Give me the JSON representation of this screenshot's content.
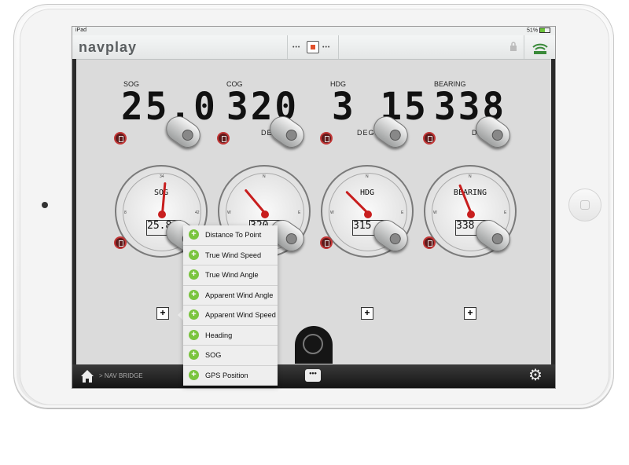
{
  "status": {
    "device": "iPad",
    "battery": "51%"
  },
  "app": {
    "logo": "navplay",
    "breadcrumb": "> NAV BRIDGE"
  },
  "instruments": [
    {
      "label": "SOG",
      "value": "25.0",
      "unit": ""
    },
    {
      "label": "COG",
      "value": "320",
      "unit": "DEG"
    },
    {
      "label": "HDG",
      "value": "3 15",
      "unit": "DEGREE"
    },
    {
      "label": "BEARING",
      "value": "338",
      "unit": "DEG"
    }
  ],
  "dials": [
    {
      "name": "SOG",
      "readout": "25.8",
      "needle_angle_deg": 5
    },
    {
      "name": "",
      "readout": "320",
      "needle_angle_deg": -40
    },
    {
      "name": "HDG",
      "readout": "315",
      "needle_angle_deg": -45
    },
    {
      "name": "BEARING",
      "readout": "338",
      "needle_angle_deg": -22
    }
  ],
  "menu": {
    "items": [
      "Distance To Point",
      "True Wind Speed",
      "True Wind Angle",
      "Apparent Wind Angle",
      "Apparent Wind Speed",
      "Heading",
      "SOG",
      "GPS Position"
    ]
  },
  "icons": {
    "home": "home-icon",
    "settings": "gear-icon",
    "chat": "chat-icon",
    "helm": "helm-wheel-icon"
  },
  "colors": {
    "accent_red": "#c81e1e",
    "menu_green": "#7ac43e",
    "bar_dark": "#1e1e1e"
  }
}
